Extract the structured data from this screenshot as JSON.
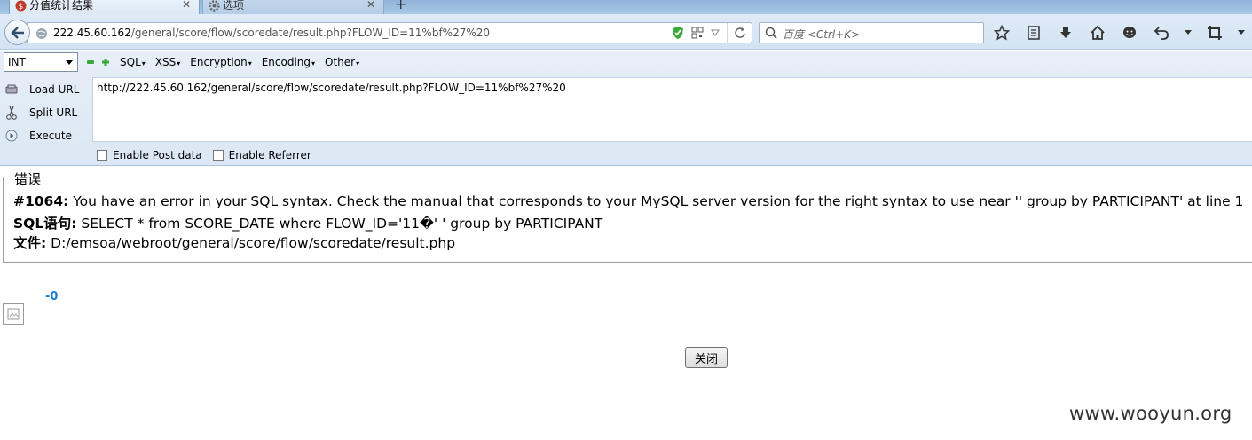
{
  "tabs": [
    {
      "label": "分值统计结果",
      "active": true
    },
    {
      "label": "选项",
      "active": false
    }
  ],
  "nav": {
    "url_host": "222.45.60.162",
    "url_path": "/general/score/flow/scoredate/result.php?FLOW_ID=11%bf%27%20",
    "search_placeholder": "百度 <Ctrl+K>"
  },
  "hackbar": {
    "select_value": "INT",
    "menus": [
      "SQL",
      "XSS",
      "Encryption",
      "Encoding",
      "Other"
    ],
    "load_url": "Load URL",
    "split_url": "Split URL",
    "execute": "Execute",
    "url_value": "http://222.45.60.162/general/score/flow/scoredate/result.php?FLOW_ID=11%bf%27%20",
    "enable_post": "Enable Post data",
    "enable_referrer": "Enable Referrer"
  },
  "error": {
    "legend": "错误",
    "code_label": "#1064:",
    "message": "You have an error in your SQL syntax. Check the manual that corresponds to your MySQL server version for the right syntax to use near '' group by PARTICIPANT' at line 1",
    "sql_label": "SQL语句:",
    "sql": "SELECT * from SCORE_DATE where FLOW_ID='11�' ' group by PARTICIPANT",
    "file_label": "文件:",
    "file": "D:/emsoa/webroot/general/score/flow/scoredate/result.php"
  },
  "page": {
    "value": "-0",
    "close_button": "关闭",
    "watermark": "www.wooyun.org"
  }
}
